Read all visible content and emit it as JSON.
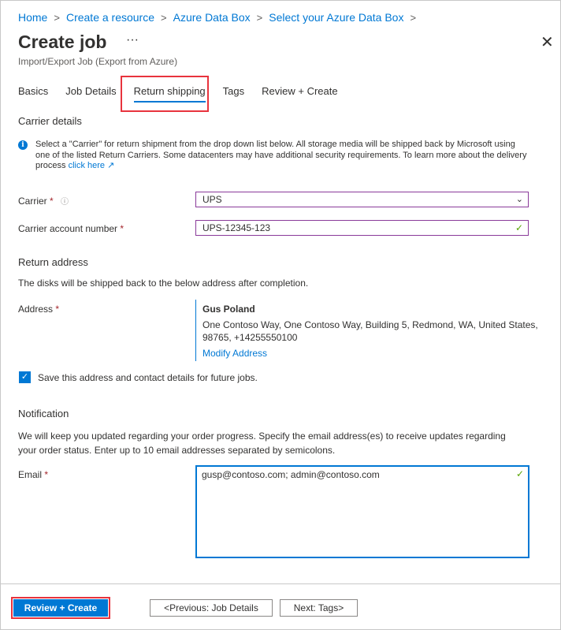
{
  "breadcrumb": [
    "Home",
    "Create a resource",
    "Azure Data Box",
    "Select your Azure Data Box"
  ],
  "header": {
    "title": "Create job",
    "more": "···",
    "subtitle": "Import/Export Job (Export from Azure)",
    "close": "✕"
  },
  "tabs": [
    "Basics",
    "Job Details",
    "Return shipping",
    "Tags",
    "Review + Create"
  ],
  "carrier_details": {
    "title": "Carrier details",
    "info_text": "Select a \"Carrier\" for return shipment from the drop down list below. All storage media will be shipped back by Microsoft using one of the listed Return Carriers. Some datacenters may have additional security requirements. To learn more about the delivery process",
    "info_link": "click here",
    "carrier_label": "Carrier",
    "carrier_value": "UPS",
    "account_label": "Carrier account number",
    "account_value": "UPS-12345-123"
  },
  "return_address": {
    "title": "Return address",
    "description": "The disks will be shipped back to the below address after completion.",
    "label": "Address",
    "name": "Gus Poland",
    "lines": "One Contoso Way, One Contoso Way, Building 5, Redmond, WA, United States, 98765, +14255550100",
    "modify_link": "Modify Address",
    "save_checkbox_label": "Save this address and contact details for future jobs.",
    "save_checked": true
  },
  "notification": {
    "title": "Notification",
    "description": "We will keep you updated regarding your order progress. Specify the email address(es) to receive updates regarding your order status. Enter up to 10 email addresses separated by semicolons.",
    "email_label": "Email",
    "email_value": "gusp@contoso.com; admin@contoso.com"
  },
  "footer": {
    "review_create": "Review + Create",
    "previous": "<Previous: Job Details",
    "next": "Next: Tags>"
  },
  "required_mark": "*"
}
